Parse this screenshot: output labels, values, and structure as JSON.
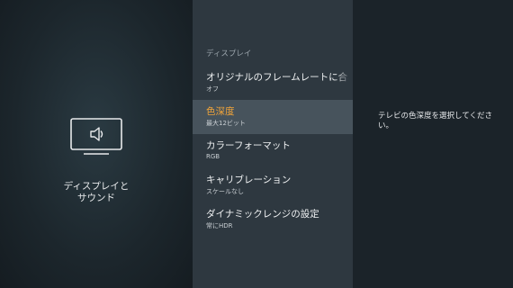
{
  "left": {
    "icon": "tv-speaker-icon",
    "caption_line1": "ディスプレイと",
    "caption_line2": "サウンド"
  },
  "menu": {
    "section_title": "ディスプレイ",
    "items": [
      {
        "label": "オリジナルのフレームレートに合わせる",
        "value": "オフ"
      },
      {
        "label": "色深度",
        "value": "最大12ビット",
        "selected": true
      },
      {
        "label": "カラーフォーマット",
        "value": "RGB"
      },
      {
        "label": "キャリブレーション",
        "value": "スケールなし"
      },
      {
        "label": "ダイナミックレンジの設定",
        "value": "常にHDR"
      }
    ]
  },
  "help": {
    "text": "テレビの色深度を選択してください。"
  },
  "colors": {
    "accent": "#f0a43a",
    "menu_bg": "#2e3840",
    "selected_bg": "#47535c",
    "page_bg": "#1b2329"
  }
}
